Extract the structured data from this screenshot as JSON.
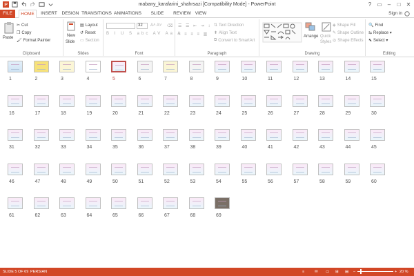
{
  "window": {
    "title": "mabany_karafarini_shahrsazi [Compatibility Mode] - PowerPoint",
    "sign_in": "Sign in"
  },
  "tabs": [
    "FILE",
    "HOME",
    "INSERT",
    "DESIGN",
    "TRANSITIONS",
    "ANIMATIONS",
    "SLIDE SHOW",
    "REVIEW",
    "VIEW"
  ],
  "active_tab": "HOME",
  "ribbon": {
    "clipboard": {
      "label": "Clipboard",
      "paste": "Paste",
      "cut": "Cut",
      "copy": "Copy",
      "format_painter": "Format Painter"
    },
    "slides": {
      "label": "Slides",
      "new_slide": "New",
      "new_slide2": "Slide",
      "layout": "Layout",
      "reset": "Reset",
      "section": "Section"
    },
    "font": {
      "label": "Font",
      "size": "32"
    },
    "paragraph": {
      "label": "Paragraph",
      "text_direction": "Text Direction",
      "align_text": "Align Text",
      "convert_smartart": "Convert to SmartArt"
    },
    "drawing": {
      "label": "Drawing",
      "arrange": "Arrange",
      "quick_styles": "Quick",
      "quick_styles2": "Styles",
      "shape_fill": "Shape Fill",
      "shape_outline": "Shape Outline",
      "shape_effects": "Shape Effects"
    },
    "editing": {
      "label": "Editing",
      "find": "Find",
      "replace": "Replace",
      "select": "Select"
    }
  },
  "slides": {
    "count": 69,
    "selected": 5,
    "numbers": [
      "1",
      "2",
      "3",
      "4",
      "5",
      "6",
      "7",
      "8",
      "9",
      "10",
      "11",
      "12",
      "13",
      "14",
      "15",
      "16",
      "17",
      "18",
      "19",
      "20",
      "21",
      "22",
      "23",
      "24",
      "25",
      "26",
      "27",
      "28",
      "29",
      "30",
      "31",
      "32",
      "33",
      "34",
      "35",
      "36",
      "37",
      "38",
      "39",
      "40",
      "41",
      "42",
      "43",
      "44",
      "45",
      "46",
      "47",
      "48",
      "49",
      "50",
      "51",
      "52",
      "53",
      "54",
      "55",
      "56",
      "57",
      "58",
      "59",
      "60",
      "61",
      "62",
      "63",
      "64",
      "65",
      "66",
      "67",
      "68",
      "69"
    ]
  },
  "status": {
    "slide_of": "SLIDE 5 OF 69",
    "language": "PERSIAN",
    "zoom": "20 %"
  },
  "colors": {
    "accent": "#d24726",
    "selected_border": "#c0504d"
  }
}
